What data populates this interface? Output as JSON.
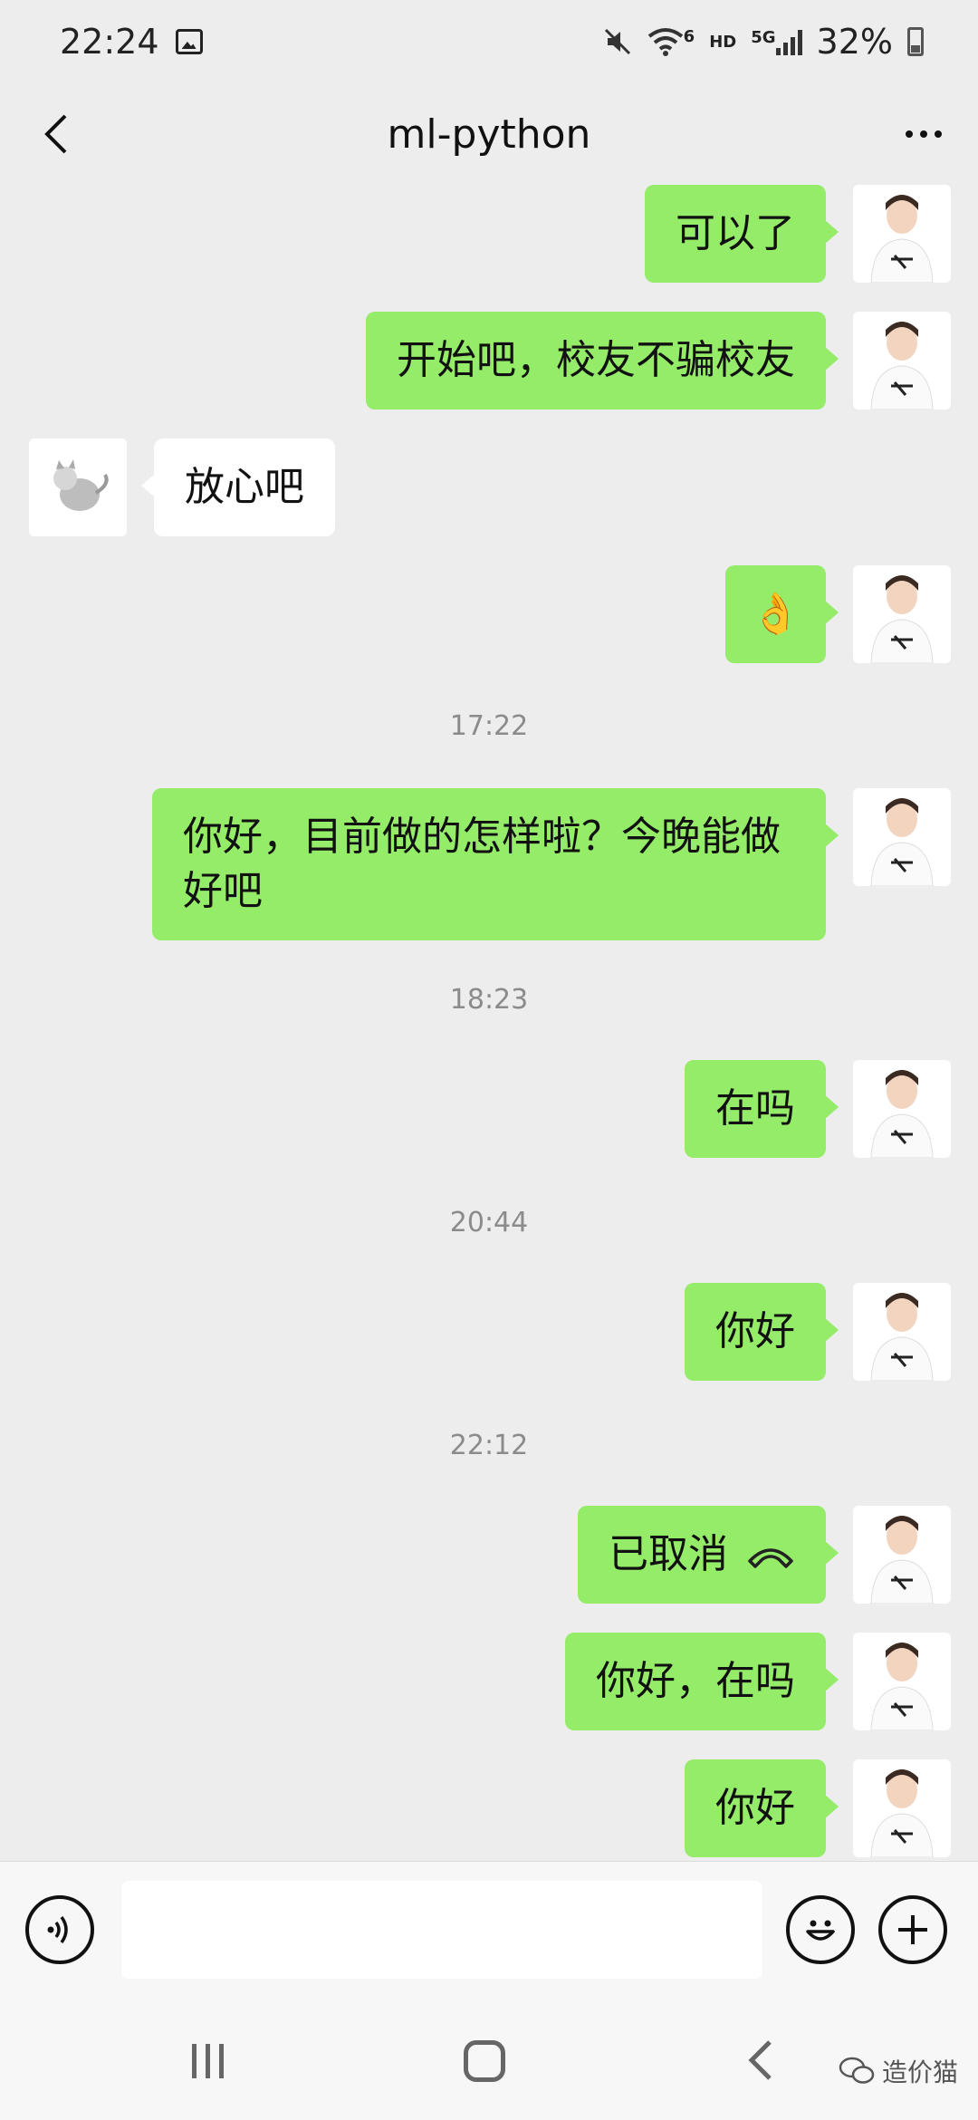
{
  "status_bar": {
    "time": "22:24",
    "hd_label": "HD",
    "net_label": "5G",
    "wifi_tag": "6",
    "battery": "32%"
  },
  "header": {
    "title": "ml-python"
  },
  "messages": [
    {
      "side": "right",
      "text": "可以了"
    },
    {
      "side": "right",
      "text": "开始吧，校友不骗校友"
    },
    {
      "side": "left",
      "text": "放心吧"
    },
    {
      "side": "right",
      "text": "👌"
    },
    {
      "type": "time",
      "text": "17:22"
    },
    {
      "side": "right",
      "text": "你好，目前做的怎样啦？今晚能做好吧"
    },
    {
      "type": "time",
      "text": "18:23"
    },
    {
      "side": "right",
      "text": "在吗"
    },
    {
      "type": "time",
      "text": "20:44"
    },
    {
      "side": "right",
      "text": "你好"
    },
    {
      "type": "time",
      "text": "22:12"
    },
    {
      "side": "right",
      "text": "已取消",
      "icon": "phone-hangup-icon"
    },
    {
      "side": "right",
      "text": "你好，在吗"
    },
    {
      "side": "right",
      "text": "你好"
    }
  ],
  "watermark": {
    "text": "造价猫"
  },
  "icons": {
    "back": "chevron-left-icon",
    "more": "more-dots-icon",
    "voice": "voice-icon",
    "emoji": "emoji-icon",
    "plus": "plus-icon"
  },
  "colors": {
    "bubble_self": "#95ec69",
    "bubble_other": "#ffffff",
    "background": "#ededed"
  }
}
